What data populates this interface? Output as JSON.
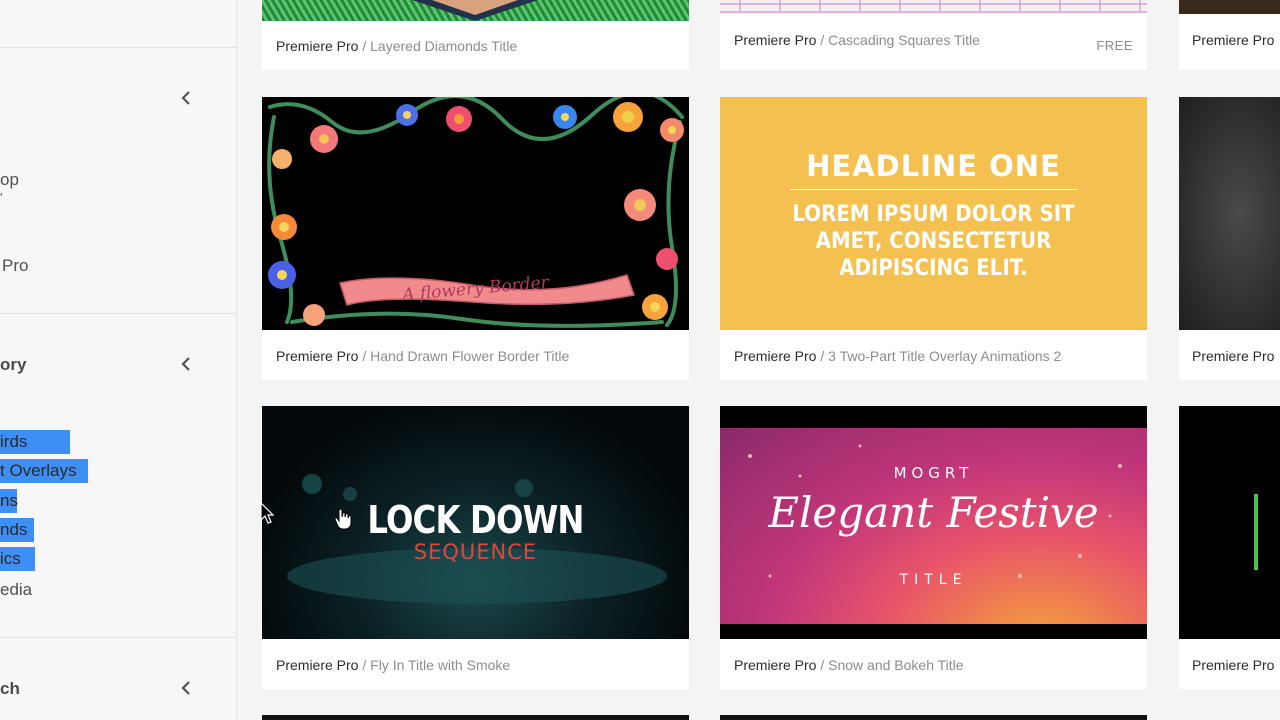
{
  "sidebar": {
    "section1": {
      "items": [
        "op",
        "'",
        "Pro"
      ]
    },
    "section2": {
      "header": "ory",
      "items": [
        {
          "label": "irds",
          "selected": true
        },
        {
          "label": "t Overlays",
          "selected": true
        },
        {
          "label": "ns",
          "selected": true
        },
        {
          "label": "nds",
          "selected": true
        },
        {
          "label": "ics",
          "selected": true
        },
        {
          "label": "edia",
          "selected": false
        }
      ]
    },
    "section3": {
      "header": "ch"
    }
  },
  "cards": [
    {
      "app": "Premiere Pro",
      "sep": " / ",
      "title": "Layered Diamonds Title"
    },
    {
      "app": "Premiere Pro",
      "sep": " / ",
      "title": "Cascading Squares Title",
      "badge": "FREE"
    },
    {
      "app": "Premiere Pro"
    },
    {
      "app": "Premiere Pro",
      "sep": " / ",
      "title": "Hand Drawn Flower Border Title",
      "banner": "A flowery Border"
    },
    {
      "app": "Premiere Pro",
      "sep": " / ",
      "title": "3 Two-Part Title Overlay Animations 2",
      "headline": "HEADLINE ONE",
      "body": [
        "LOREM IPSUM DOLOR SIT",
        "AMET, CONSECTETUR",
        "ADIPISCING ELIT."
      ]
    },
    {
      "app": "Premiere Pro"
    },
    {
      "app": "Premiere Pro",
      "sep": " / ",
      "title": "Fly In Title with Smoke",
      "line1": "LOCK DOWN",
      "line2": "SEQUENCE"
    },
    {
      "app": "Premiere Pro",
      "sep": " / ",
      "title": "Snow and Bokeh Title",
      "top": "MOGRT",
      "script": "Elegant Festive",
      "bottom": "TITLE"
    },
    {
      "app": "Premiere Pro"
    }
  ],
  "colors": {
    "selection": "#3d8ff5",
    "yellow_card": "#f4c150",
    "banner": "#f08a8c"
  }
}
